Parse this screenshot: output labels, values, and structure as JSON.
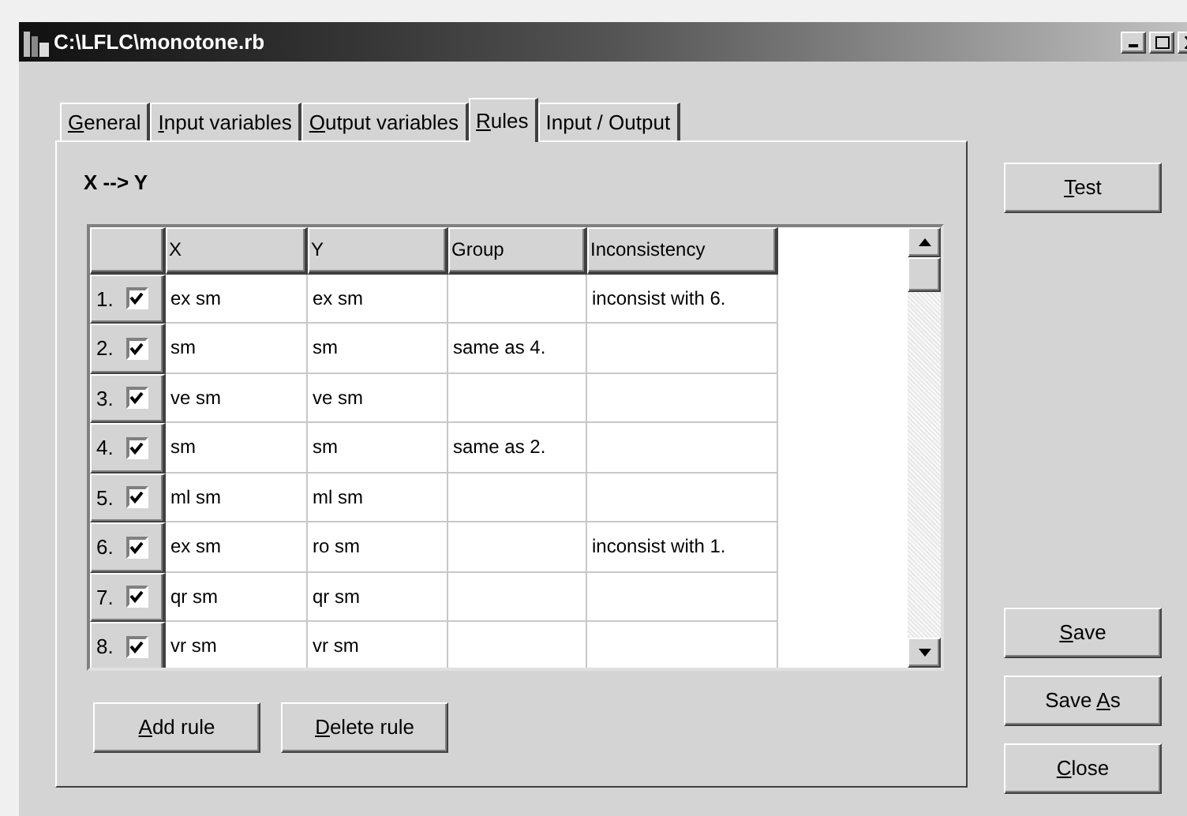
{
  "window": {
    "title": "C:\\LFLC\\monotone.rb"
  },
  "tabs": [
    {
      "label": {
        "key": "G",
        "after": "eneral"
      },
      "selected": false
    },
    {
      "label": {
        "key": "I",
        "after": "nput variables"
      },
      "selected": false
    },
    {
      "label": {
        "key": "O",
        "after": "utput variables"
      },
      "selected": false
    },
    {
      "label": {
        "key": "R",
        "after": "ules"
      },
      "selected": true
    },
    {
      "label": {
        "before": "Input / Output"
      },
      "selected": false
    }
  ],
  "panel_title": "X --> Y",
  "table": {
    "columns": [
      "X",
      "Y",
      "Group",
      "Inconsistency"
    ],
    "rows": [
      {
        "number": "1.",
        "checked": true,
        "cells": [
          "ex sm",
          "ex sm",
          "",
          "inconsist with 6."
        ]
      },
      {
        "number": "2.",
        "checked": true,
        "cells": [
          "sm",
          "sm",
          "same as 4.",
          ""
        ]
      },
      {
        "number": "3.",
        "checked": true,
        "cells": [
          "ve sm",
          "ve sm",
          "",
          ""
        ]
      },
      {
        "number": "4.",
        "checked": true,
        "cells": [
          "sm",
          "sm",
          "same as 2.",
          ""
        ]
      },
      {
        "number": "5.",
        "checked": true,
        "cells": [
          "ml sm",
          "ml sm",
          "",
          ""
        ]
      },
      {
        "number": "6.",
        "checked": true,
        "cells": [
          "ex sm",
          "ro sm",
          "",
          "inconsist with 1."
        ]
      },
      {
        "number": "7.",
        "checked": true,
        "cells": [
          "qr sm",
          "qr sm",
          "",
          ""
        ]
      },
      {
        "number": "8.",
        "checked": true,
        "cells": [
          "vr sm",
          "vr sm",
          "",
          ""
        ]
      }
    ]
  },
  "panel_buttons": [
    {
      "label": {
        "key": "A",
        "after": "dd rule"
      }
    },
    {
      "label": {
        "key": "D",
        "after": "elete rule"
      }
    }
  ],
  "side_buttons": [
    {
      "label": {
        "key": "T",
        "after": "est"
      },
      "kind": "top"
    },
    {
      "label": {
        "key": "S",
        "after": "ave"
      },
      "kind": "bottom"
    },
    {
      "label": {
        "before": "Save ",
        "key": "A",
        "after": "s"
      },
      "kind": "bottom"
    },
    {
      "label": {
        "key": "C",
        "after": "lose"
      },
      "kind": "bottom"
    }
  ]
}
